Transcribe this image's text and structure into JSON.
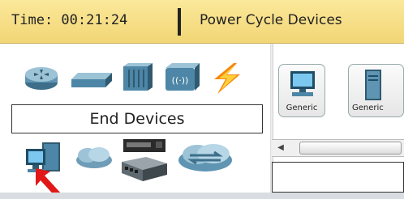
{
  "topbar": {
    "time": "Time: 00:21:24",
    "power_cycle": "Power Cycle Devices"
  },
  "categories": {
    "row1_icons": [
      "router-icon",
      "switch-icon",
      "hub-icon",
      "wireless-device-icon",
      "connections-icon"
    ],
    "selected_label": "End Devices",
    "row2_icons": [
      "end-devices-icon",
      "wan-emulation-icon",
      "custom-made-devices-icon",
      "multiuser-connection-icon"
    ]
  },
  "devices": [
    {
      "label": "Generic",
      "icon": "pc-icon"
    },
    {
      "label": "Generic",
      "icon": "server-icon"
    }
  ],
  "colors": {
    "topbar": "#f2d676",
    "accent_blue": "#3a7cc8",
    "pointer_red": "#e01818"
  }
}
